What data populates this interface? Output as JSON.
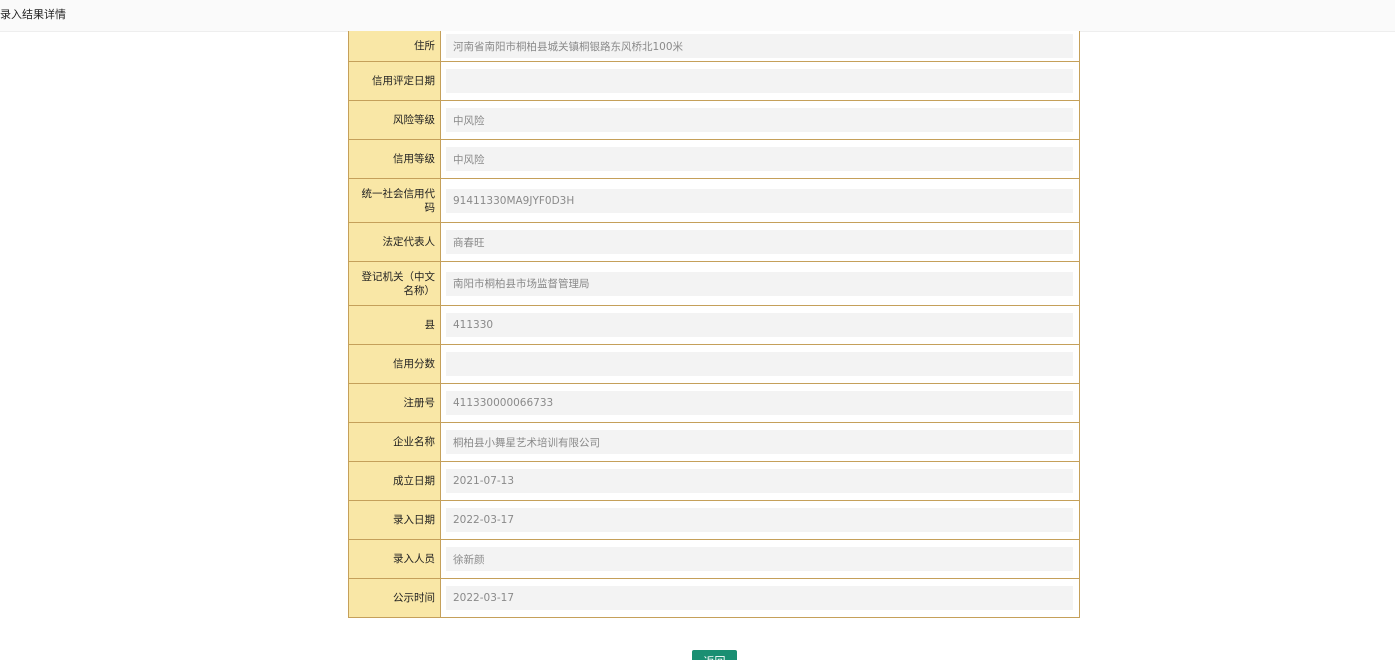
{
  "header": {
    "title": "录入结果详情"
  },
  "fields": [
    {
      "label": "住所",
      "value": "河南省南阳市桐柏县城关镇桐银路东风桥北100米"
    },
    {
      "label": "信用评定日期",
      "value": ""
    },
    {
      "label": "风险等级",
      "value": "中风险"
    },
    {
      "label": "信用等级",
      "value": "中风险"
    },
    {
      "label": "统一社会信用代码",
      "value": "91411330MA9JYF0D3H"
    },
    {
      "label": "法定代表人",
      "value": "商春旺"
    },
    {
      "label": "登记机关（中文名称）",
      "value": "南阳市桐柏县市场监督管理局"
    },
    {
      "label": "县",
      "value": "411330"
    },
    {
      "label": "信用分数",
      "value": ""
    },
    {
      "label": "注册号",
      "value": "411330000066733"
    },
    {
      "label": "企业名称",
      "value": "桐柏县小舞星艺术培训有限公司"
    },
    {
      "label": "成立日期",
      "value": "2021-07-13"
    },
    {
      "label": "录入日期",
      "value": "2022-03-17"
    },
    {
      "label": "录入人员",
      "value": "徐新颜"
    },
    {
      "label": "公示时间",
      "value": "2022-03-17"
    }
  ],
  "footer": {
    "return_label": "返回"
  },
  "colors": {
    "label_background": "#f9e7a6",
    "table_border": "#c5a05a",
    "value_background": "#f3f3f3",
    "button_background": "#1a8f72"
  }
}
